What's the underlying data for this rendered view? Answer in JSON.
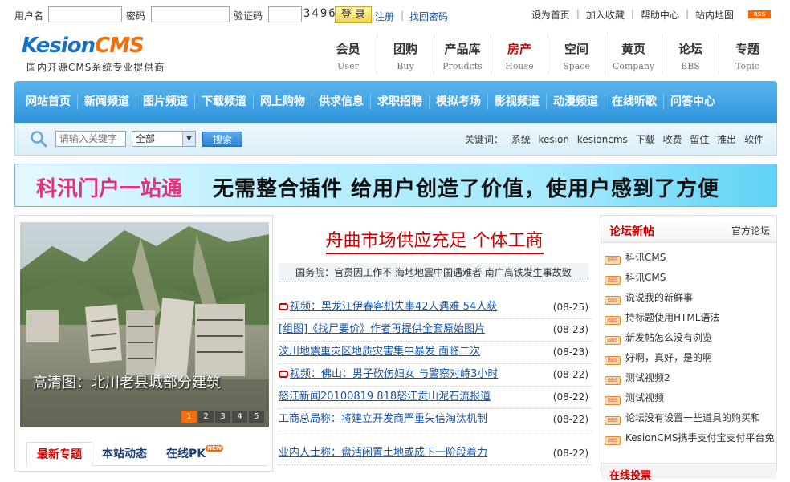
{
  "topbar": {
    "username_label": "用户名",
    "password_label": "密码",
    "captcha_label": "验证码",
    "captcha_code": "3496",
    "login_label": "登 录",
    "register_label": "注册",
    "findpw_label": "找回密码",
    "links": [
      "设为首页",
      "加入收藏",
      "帮助中心",
      "站内地图"
    ],
    "rss_label": "RSS"
  },
  "logo": {
    "brand_a": "Kesion",
    "brand_b": "CMS",
    "slogan": "国内开源CMS系统专业提供商"
  },
  "channels": [
    {
      "cn": "会员",
      "en": "User"
    },
    {
      "cn": "团购",
      "en": "Buy"
    },
    {
      "cn": "产品库",
      "en": "Proudcts"
    },
    {
      "cn": "房产",
      "en": "House"
    },
    {
      "cn": "空间",
      "en": "Space"
    },
    {
      "cn": "黄页",
      "en": "Company"
    },
    {
      "cn": "论坛",
      "en": "BBS"
    },
    {
      "cn": "专题",
      "en": "Topic"
    }
  ],
  "nav": [
    "网站首页",
    "新闻频道",
    "图片频道",
    "下载频道",
    "网上购物",
    "供求信息",
    "求职招聘",
    "模拟考场",
    "影视频道",
    "动漫频道",
    "在线听歌",
    "问答中心"
  ],
  "search": {
    "placeholder": "请输入关键字",
    "select_value": "全部",
    "button_label": "搜索",
    "keywords_label": "关键词：",
    "keywords": [
      "系统",
      "kesion",
      "kesioncms",
      "下载",
      "收费",
      "留住",
      "推出",
      "软件"
    ]
  },
  "banner": {
    "part1": "科汛门户一站通",
    "part2": "无需整合插件  给用户创造了价值，使用户感到了方便"
  },
  "photo": {
    "caption": "高清图：北川老县城部分建筑",
    "pages": [
      "1",
      "2",
      "3",
      "4",
      "5"
    ],
    "tabs": [
      "最新专题",
      "本站动态",
      "在线PK"
    ],
    "new_tag": "NEW"
  },
  "news": {
    "headline": "舟曲市场供应充足  个体工商",
    "subhead": "国务院：官员因工作不  海地地震中国遇难者  南广高铁发生事故致",
    "items": [
      {
        "title": "视频：黑龙江伊春客机失事42人遇难 54人获",
        "date": "(08-25)",
        "video": true
      },
      {
        "title": "[组图]《找尸要价》作者再提供全套原始图片",
        "date": "(08-23)"
      },
      {
        "title": "汶川地震重灾区地质灾害集中暴发 面临二次",
        "date": "(08-23)"
      },
      {
        "title": "视频：佛山：男子砍伤妇女 与警察对峙3小时",
        "date": "(08-22)",
        "video": true
      },
      {
        "title": "怒江新闻20100819 818怒江贡山泥石流报道",
        "date": "(08-22)"
      },
      {
        "title": "工商总局称：将建立开发商严重失信淘汰机制",
        "date": "(08-22)"
      },
      {
        "title": "业内人士称：盘活闲置土地或成下一阶段着力",
        "date": "(08-22)"
      }
    ]
  },
  "forum": {
    "title": "论坛新帖",
    "more": "官方论坛",
    "icon_text": "BBS",
    "items": [
      "科讯CMS",
      "科讯CMS",
      "说说我的新鲜事",
      "持标题使用HTML语法",
      "新发帖怎么没有浏览",
      "好啊，真好，是的啊",
      "测试视频2",
      "测试视频",
      "论坛没有设置一些道具的购买和",
      "KesionCMS携手支付宝支付平台免"
    ],
    "next_title": "在线投票"
  }
}
